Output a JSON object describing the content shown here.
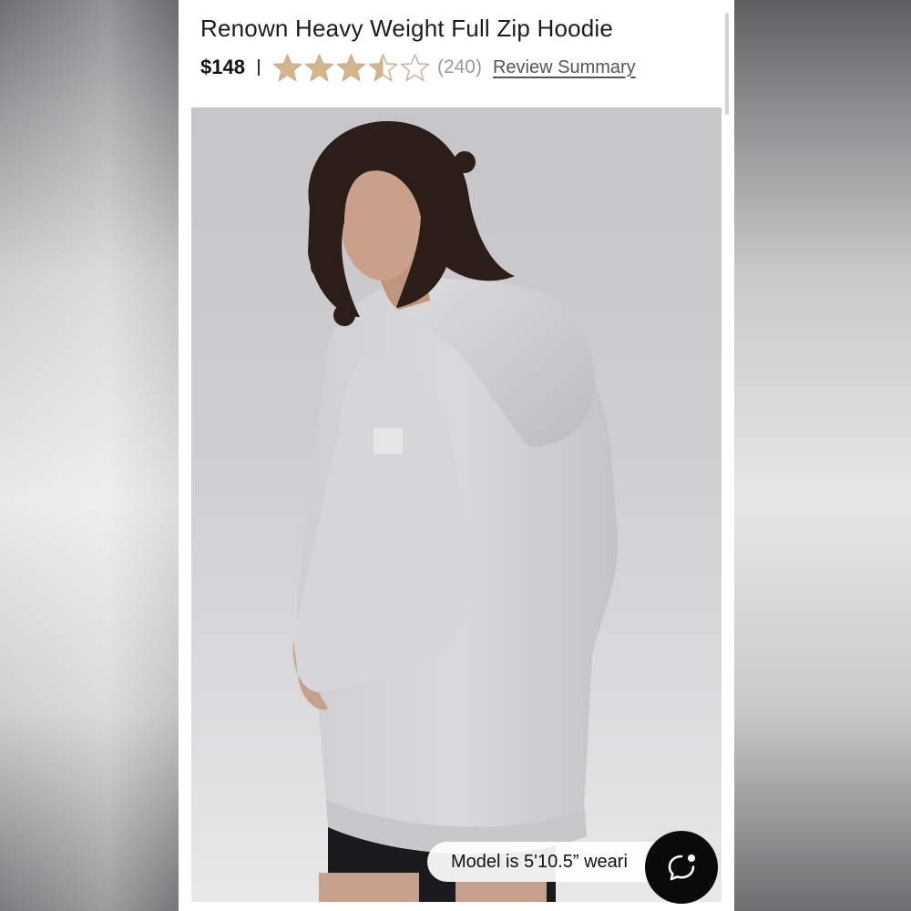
{
  "product": {
    "title": "Renown Heavy Weight Full Zip Hoodie",
    "price": "$148",
    "rating": {
      "value": 3.5,
      "max": 5,
      "count_text": "(240)"
    },
    "review_summary_label": "Review Summary"
  },
  "image": {
    "alt": "Model wearing heather grey full zip hoodie, hood up behind head",
    "model_note": "Model is 5'10.5” weari"
  },
  "colors": {
    "star_fill": "#d3b48c",
    "star_empty_stroke": "#c9b08c",
    "hoodie": "#d4d4d6",
    "chat_button": "#0a0a0a"
  },
  "icons": {
    "rating": "star-icon",
    "chat": "chat-bubble-icon"
  }
}
